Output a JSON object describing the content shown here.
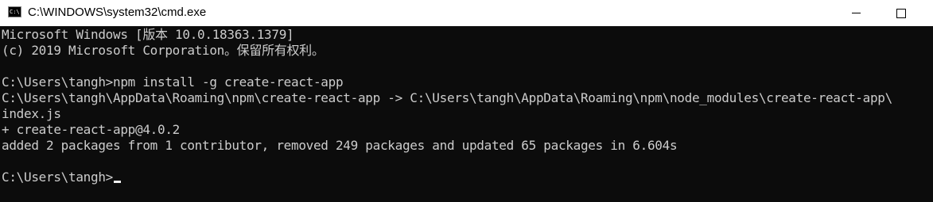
{
  "window": {
    "title": "C:\\WINDOWS\\system32\\cmd.exe",
    "icon": "cmd-app-icon",
    "icon_text": "C:\\."
  },
  "controls": {
    "minimize": "minimize-icon",
    "maximize": "maximize-icon"
  },
  "console": {
    "lines": [
      "Microsoft Windows [版本 10.0.18363.1379]",
      "(c) 2019 Microsoft Corporation。保留所有权利。",
      "",
      "C:\\Users\\tangh>npm install -g create-react-app",
      "C:\\Users\\tangh\\AppData\\Roaming\\npm\\create-react-app -> C:\\Users\\tangh\\AppData\\Roaming\\npm\\node_modules\\create-react-app\\",
      "index.js",
      "+ create-react-app@4.0.2",
      "added 2 packages from 1 contributor, removed 249 packages and updated 65 packages in 6.604s",
      ""
    ],
    "prompt": "C:\\Users\\tangh>",
    "colors": {
      "background": "#0c0c0c",
      "foreground": "#cccccc",
      "cursor": "#f2f2f2"
    }
  }
}
